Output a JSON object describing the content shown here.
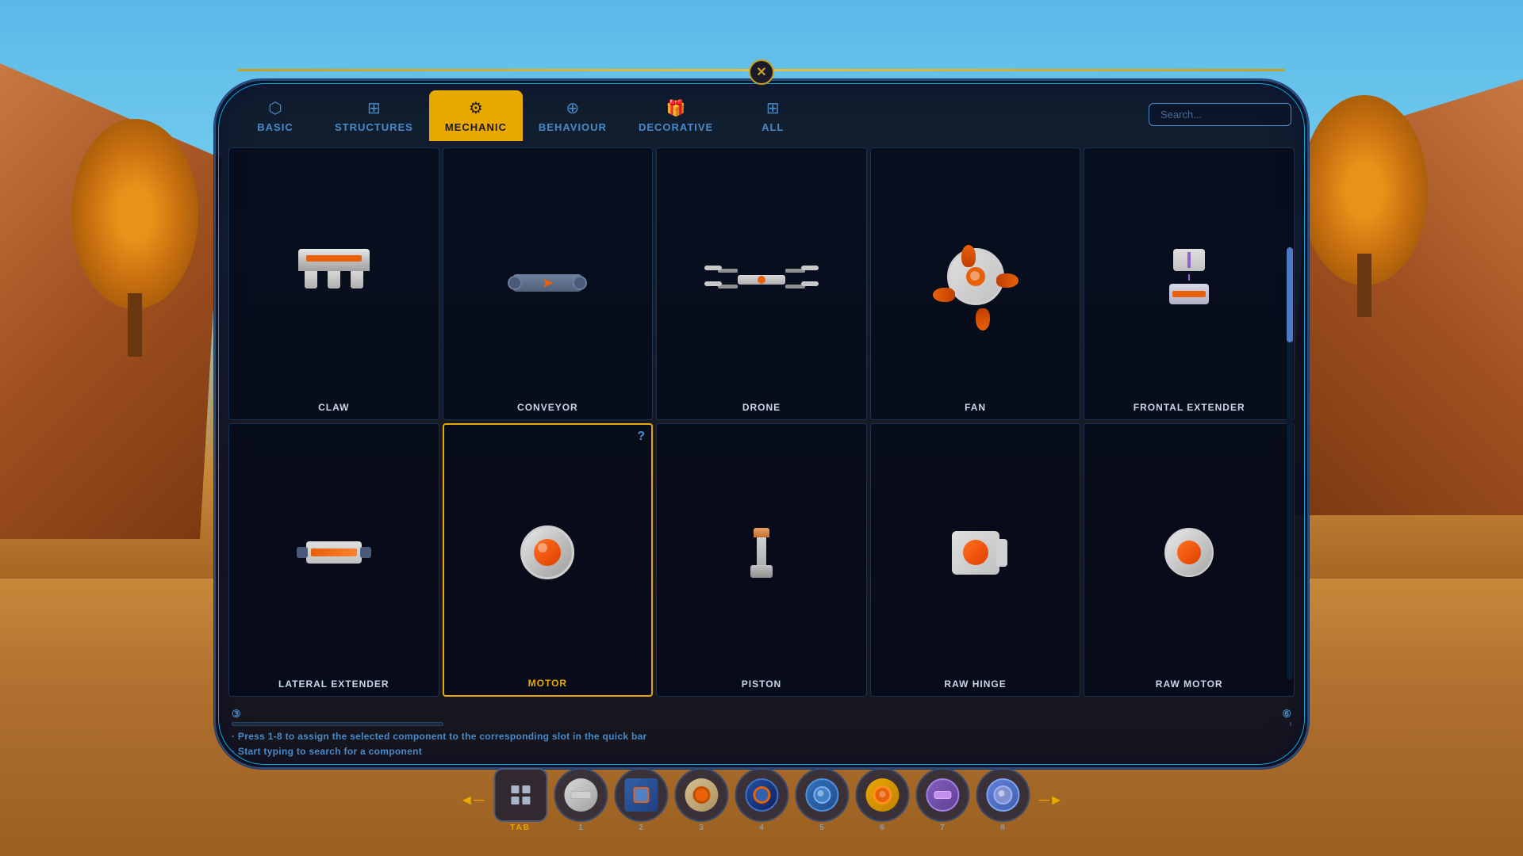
{
  "background": {
    "sky_color": "#5bb8e8",
    "ground_color": "#c8883a"
  },
  "panel": {
    "close_button": "✕",
    "border_color": "#00aadd",
    "accent_color": "#e8a800"
  },
  "tabs": [
    {
      "id": "basic",
      "label": "BASIC",
      "icon": "⬡",
      "active": false
    },
    {
      "id": "structures",
      "label": "STRUCTURES",
      "icon": "⊞",
      "active": false
    },
    {
      "id": "mechanic",
      "label": "MECHANIC",
      "icon": "⚙",
      "active": true
    },
    {
      "id": "behaviour",
      "label": "BEHAVIOUR",
      "icon": "⊕",
      "active": false
    },
    {
      "id": "decorative",
      "label": "DECORATIVE",
      "icon": "🎁",
      "active": false
    },
    {
      "id": "all",
      "label": "ALL",
      "icon": "⊞",
      "active": false
    }
  ],
  "search": {
    "placeholder": "Search..."
  },
  "grid_items": [
    {
      "id": "claw",
      "label": "CLAW",
      "shape": "claw",
      "selected": false,
      "has_question": false,
      "row": 1
    },
    {
      "id": "conveyor",
      "label": "CONVEYOR",
      "shape": "conveyor",
      "selected": false,
      "has_question": false,
      "row": 1
    },
    {
      "id": "drone",
      "label": "DRONE",
      "shape": "drone",
      "selected": false,
      "has_question": false,
      "row": 1
    },
    {
      "id": "fan",
      "label": "FAN",
      "shape": "fan",
      "selected": false,
      "has_question": false,
      "row": 1
    },
    {
      "id": "frontal-extender",
      "label": "FRONTAL EXTENDER",
      "shape": "frontal",
      "selected": false,
      "has_question": false,
      "row": 1
    },
    {
      "id": "lateral-extender",
      "label": "LATERAL EXTENDER",
      "shape": "lateral",
      "selected": false,
      "has_question": false,
      "row": 2
    },
    {
      "id": "motor",
      "label": "MOTOR",
      "shape": "motor",
      "selected": true,
      "has_question": true,
      "row": 2
    },
    {
      "id": "piston",
      "label": "PISTON",
      "shape": "piston",
      "selected": false,
      "has_question": false,
      "row": 2
    },
    {
      "id": "raw-hinge",
      "label": "RAW HINGE",
      "shape": "rawhinge",
      "selected": false,
      "has_question": false,
      "row": 2
    },
    {
      "id": "raw-motor",
      "label": "RAW MOTOR",
      "shape": "rawmotor",
      "selected": false,
      "has_question": false,
      "row": 2
    }
  ],
  "info": {
    "slot_3_label": "③",
    "slot_6_label": "⑥",
    "hint_1": "· Press 1-8 to assign the selected component to the corresponding slot in the quick bar",
    "hint_2": "· Start typing to search for a component"
  },
  "quickbar": {
    "tab_label": "TAB",
    "left_arrow": "◄",
    "right_arrow": "►",
    "items": [
      {
        "number": "1",
        "empty": false,
        "color": "#909090"
      },
      {
        "number": "2",
        "empty": false,
        "color": "#4a7ac8"
      },
      {
        "number": "3",
        "empty": false,
        "color": "#e8600a"
      },
      {
        "number": "4",
        "empty": false,
        "color": "#2060a8"
      },
      {
        "number": "5",
        "empty": false,
        "color": "#3080c8"
      },
      {
        "number": "6",
        "empty": false,
        "color": "#e8a800"
      },
      {
        "number": "7",
        "empty": false,
        "color": "#8060c0"
      },
      {
        "number": "8",
        "empty": false,
        "color": "#6080d8"
      }
    ]
  }
}
